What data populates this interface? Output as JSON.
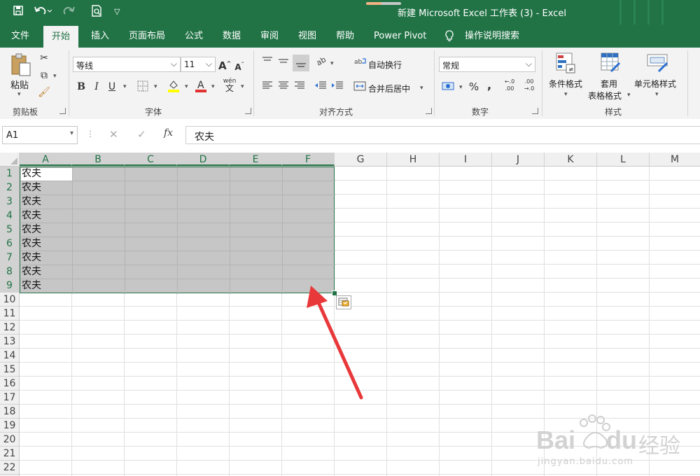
{
  "window": {
    "title": "新建 Microsoft Excel 工作表 (3)  -  Excel",
    "autosave_progress": 0.44
  },
  "qat": {
    "save_icon": "save-icon",
    "undo_icon": "undo-icon",
    "redo_icon": "redo-icon",
    "preview_icon": "print-preview-icon",
    "customize_icon": "customize-qat-icon"
  },
  "tabs": [
    {
      "label": "文件"
    },
    {
      "label": "开始"
    },
    {
      "label": "插入"
    },
    {
      "label": "页面布局"
    },
    {
      "label": "公式"
    },
    {
      "label": "数据"
    },
    {
      "label": "审阅"
    },
    {
      "label": "视图"
    },
    {
      "label": "帮助"
    },
    {
      "label": "Power Pivot"
    }
  ],
  "active_tab": "开始",
  "tell_me": "操作说明搜索",
  "ribbon": {
    "clipboard": {
      "paste": "粘贴",
      "group": "剪贴板"
    },
    "font": {
      "name": "等线",
      "size": "11",
      "grow": "A",
      "shrink": "A",
      "bold": "B",
      "italic": "I",
      "underline": "U",
      "phonetic": "wén",
      "phonetic_char": "文",
      "group": "字体",
      "accent_color": "#ffff00",
      "font_color": "#e03030"
    },
    "alignment": {
      "wrap": "自动换行",
      "merge": "合并后居中",
      "group": "对齐方式"
    },
    "number": {
      "format": "常规",
      "percent": "%",
      "comma": ",",
      "group": "数字",
      "inc": ".0\n.00",
      "dec": ".00\n.0"
    },
    "styles": {
      "conditional": "条件格式",
      "table_1": "套用",
      "table_2": "表格格式",
      "cell_styles": "单元格样式",
      "group": "样式"
    }
  },
  "formula_bar": {
    "name_box": "A1",
    "cancel": "✕",
    "enter": "✓",
    "fx": "fx",
    "value": "农夫"
  },
  "sheet": {
    "columns": [
      "A",
      "B",
      "C",
      "D",
      "E",
      "F",
      "G",
      "H",
      "I",
      "J",
      "K",
      "L",
      "M"
    ],
    "rows": [
      "1",
      "2",
      "3",
      "4",
      "5",
      "6",
      "7",
      "8",
      "9",
      "10",
      "11",
      "12",
      "13",
      "14",
      "15",
      "16",
      "17",
      "18",
      "19",
      "20",
      "21",
      "22"
    ],
    "selected_columns": [
      "A",
      "B",
      "C",
      "D",
      "E",
      "F"
    ],
    "selected_rows": [
      "1",
      "2",
      "3",
      "4",
      "5",
      "6",
      "7",
      "8",
      "9"
    ],
    "selection": "A1:F9",
    "active_cell": "A1",
    "cells_A": [
      "农夫",
      "农夫",
      "农夫",
      "农夫",
      "农夫",
      "农夫",
      "农夫",
      "农夫",
      "农夫"
    ]
  },
  "colors": {
    "excel_green": "#217346",
    "arrow_red": "#e8383a",
    "selection_gray": "#c6c6c6"
  },
  "watermark": {
    "brand": "Bai",
    "brand2": "du",
    "cn": "经验",
    "url": "jingyan.baidu.com"
  }
}
